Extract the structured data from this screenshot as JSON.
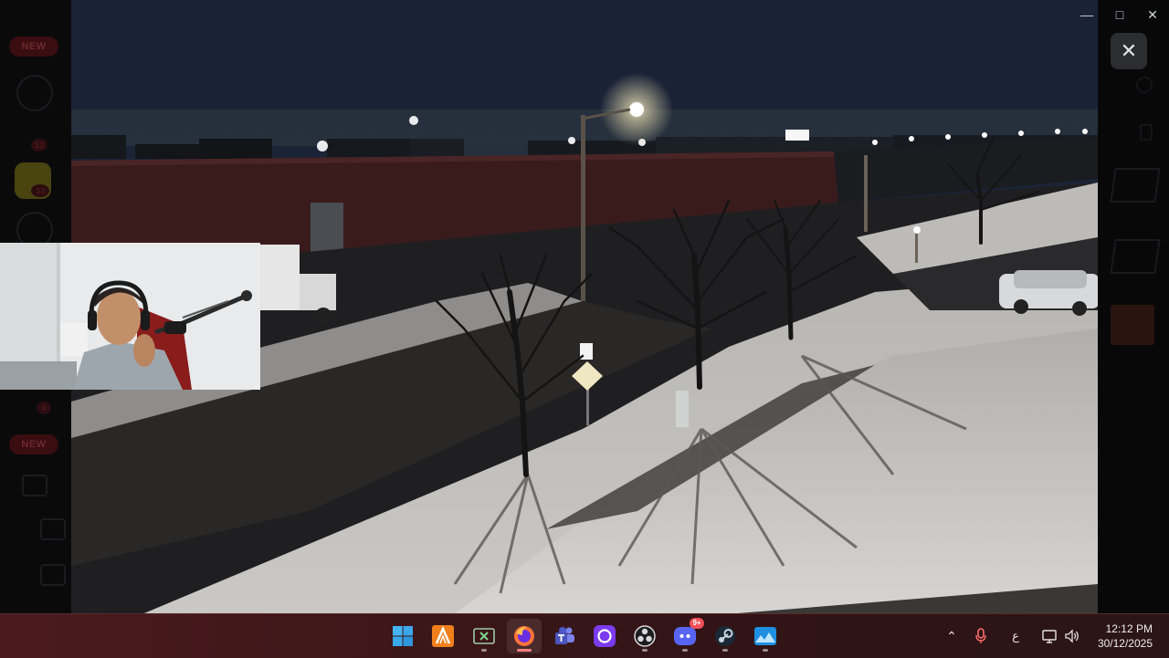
{
  "window": {
    "minimize_icon": "minimize-icon",
    "maximize_icon": "maximize-icon",
    "close_icon": "close-icon"
  },
  "viewer": {
    "close_overlay_icon": "close-icon"
  },
  "background_app": {
    "badges": [
      "NEW",
      "NEW"
    ],
    "count_badges": [
      "13",
      "33",
      "4"
    ]
  },
  "taskbar": {
    "apps": [
      {
        "name": "start",
        "icon": "windows-start-icon",
        "active": false,
        "running": false
      },
      {
        "name": "fl-studio",
        "icon": "fl-studio-icon",
        "active": false,
        "running": false
      },
      {
        "name": "xbox",
        "icon": "xbox-icon",
        "active": false,
        "running": true
      },
      {
        "name": "firefox",
        "icon": "firefox-icon",
        "active": true,
        "running": true
      },
      {
        "name": "teams",
        "icon": "teams-icon",
        "active": false,
        "running": false
      },
      {
        "name": "circle-app",
        "icon": "circle-app-icon",
        "active": false,
        "running": false
      },
      {
        "name": "obs",
        "icon": "obs-icon",
        "active": false,
        "running": true
      },
      {
        "name": "discord",
        "icon": "discord-icon",
        "active": false,
        "running": true,
        "badge": "9+"
      },
      {
        "name": "steam",
        "icon": "steam-icon",
        "active": false,
        "running": true
      },
      {
        "name": "photos",
        "icon": "photos-icon",
        "active": false,
        "running": true
      }
    ],
    "tray": {
      "overflow_icon": "chevron-up-icon",
      "mic_icon": "microphone-icon",
      "language": "ع",
      "network_icon": "network-icon",
      "volume_icon": "volume-icon"
    },
    "clock": {
      "time": "12:12 PM",
      "date": "30/12/2025"
    }
  },
  "colors": {
    "taskbar_tint": "#4b1a1e",
    "active_indicator": "#ff7f7f",
    "badge": "#f04f58"
  }
}
